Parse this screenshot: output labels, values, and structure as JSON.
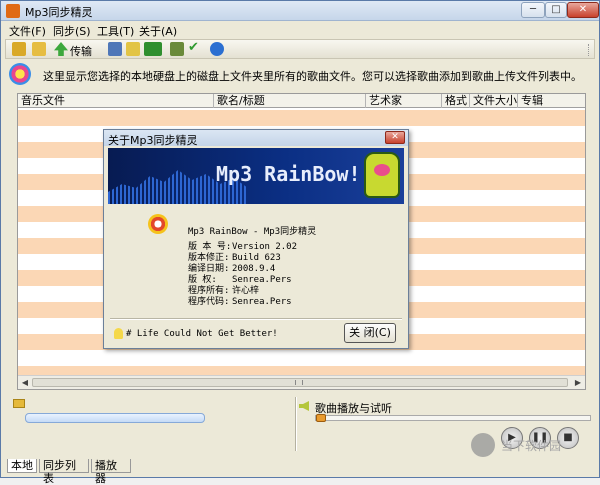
{
  "window": {
    "title": "Mp3同步精灵",
    "min_glyph": "─",
    "max_glyph": "□",
    "close_glyph": "✕"
  },
  "menu": [
    "文件(F)",
    "同步(S)",
    "工具(T)",
    "关于(A)"
  ],
  "toolbar": {
    "transfer_label": "传输"
  },
  "info": {
    "text": "这里显示您选择的本地硬盘上的磁盘上文件夹里所有的歌曲文件。您可以选择歌曲添加到歌曲上传文件列表中。"
  },
  "table": {
    "columns": [
      "音乐文件",
      "歌名/标题",
      "艺术家",
      "格式",
      "文件大小",
      "专辑"
    ]
  },
  "dialog": {
    "title": "关于Mp3同步精灵",
    "close_glyph": "✕",
    "banner_title": "Mp3 RainBow!",
    "app_name": "Mp3 RainBow  - Mp3同步精灵",
    "rows": [
      {
        "k": "版 本 号:",
        "v": "Version 2.02"
      },
      {
        "k": "版本修正:",
        "v": "Build 623"
      },
      {
        "k": "编译日期:",
        "v": "2008.9.4"
      },
      {
        "k": "版    权:",
        "v": "Senrea.Pers"
      },
      {
        "k": "程序所有:",
        "v": "许心梓"
      },
      {
        "k": "程序代码:",
        "v": "Senrea.Pers"
      }
    ],
    "slogan": "# Life Could Not Get Better!",
    "close_button": "关 闭(C)"
  },
  "player": {
    "title": "歌曲播放与试听",
    "seek_fraction": 0.0
  },
  "tabs": [
    "本地",
    "同步列表",
    "播放器"
  ],
  "watermark": "当下软件园"
}
